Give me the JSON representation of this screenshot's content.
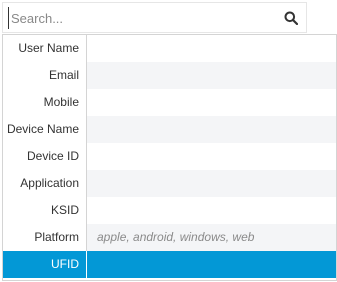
{
  "search": {
    "placeholder": "Search...",
    "value": ""
  },
  "fields": [
    {
      "label": "User Name",
      "value": ""
    },
    {
      "label": "Email",
      "value": ""
    },
    {
      "label": "Mobile",
      "value": ""
    },
    {
      "label": "Device Name",
      "value": ""
    },
    {
      "label": "Device ID",
      "value": ""
    },
    {
      "label": "Application",
      "value": ""
    },
    {
      "label": "KSID",
      "value": ""
    },
    {
      "label": "Platform",
      "value": "apple, android, windows, web"
    },
    {
      "label": "UFID",
      "value": ""
    }
  ],
  "colors": {
    "selected_row": "#0398d6",
    "alt_row": "#f4f5f7",
    "border": "#d4d4d4"
  },
  "icons": {
    "search": "search-icon"
  }
}
